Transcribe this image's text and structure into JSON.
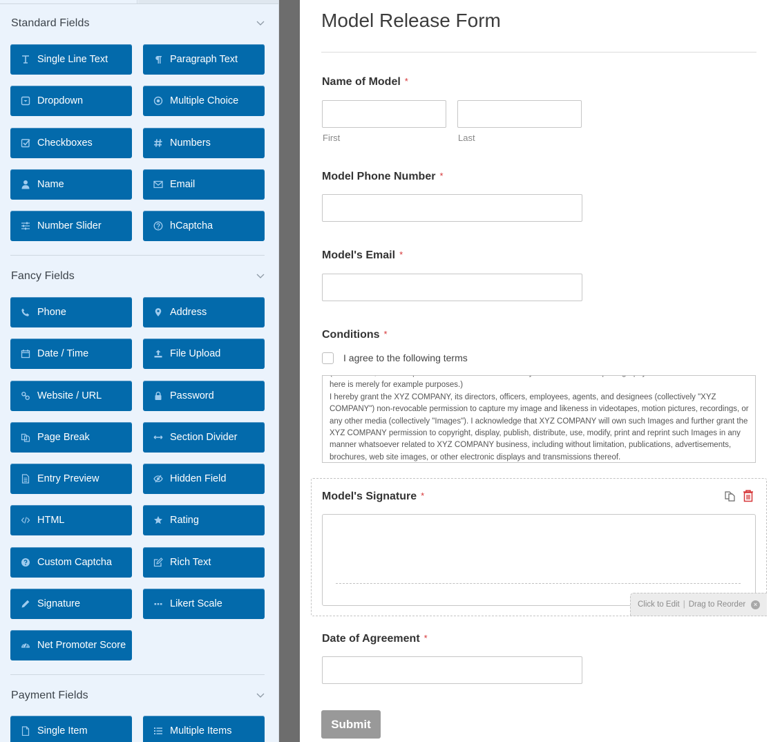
{
  "sidebar": {
    "sections": {
      "standard": {
        "title": "Standard Fields",
        "items": [
          {
            "label": "Single Line Text",
            "icon": "text-cursor-icon"
          },
          {
            "label": "Paragraph Text",
            "icon": "paragraph-icon"
          },
          {
            "label": "Dropdown",
            "icon": "dropdown-icon"
          },
          {
            "label": "Multiple Choice",
            "icon": "radio-icon"
          },
          {
            "label": "Checkboxes",
            "icon": "checkbox-icon"
          },
          {
            "label": "Numbers",
            "icon": "hash-icon"
          },
          {
            "label": "Name",
            "icon": "user-icon"
          },
          {
            "label": "Email",
            "icon": "envelope-icon"
          },
          {
            "label": "Number Slider",
            "icon": "sliders-icon"
          },
          {
            "label": "hCaptcha",
            "icon": "question-circle-icon"
          }
        ]
      },
      "fancy": {
        "title": "Fancy Fields",
        "items": [
          {
            "label": "Phone",
            "icon": "phone-icon"
          },
          {
            "label": "Address",
            "icon": "map-marker-icon"
          },
          {
            "label": "Date / Time",
            "icon": "calendar-icon"
          },
          {
            "label": "File Upload",
            "icon": "upload-icon"
          },
          {
            "label": "Website / URL",
            "icon": "link-icon"
          },
          {
            "label": "Password",
            "icon": "lock-icon"
          },
          {
            "label": "Page Break",
            "icon": "copy-icon"
          },
          {
            "label": "Section Divider",
            "icon": "arrows-h-icon"
          },
          {
            "label": "Entry Preview",
            "icon": "file-text-icon"
          },
          {
            "label": "Hidden Field",
            "icon": "eye-slash-icon"
          },
          {
            "label": "HTML",
            "icon": "code-icon"
          },
          {
            "label": "Rating",
            "icon": "star-icon"
          },
          {
            "label": "Custom Captcha",
            "icon": "question-circle-filled-icon"
          },
          {
            "label": "Rich Text",
            "icon": "edit-icon"
          },
          {
            "label": "Signature",
            "icon": "pencil-icon"
          },
          {
            "label": "Likert Scale",
            "icon": "ellipsis-icon"
          },
          {
            "label": "Net Promoter Score",
            "icon": "tachometer-icon"
          }
        ]
      },
      "payment": {
        "title": "Payment Fields",
        "items": [
          {
            "label": "Single Item",
            "icon": "file-icon"
          },
          {
            "label": "Multiple Items",
            "icon": "list-icon"
          }
        ]
      }
    }
  },
  "form": {
    "title": "Model Release Form",
    "required_marker": "*",
    "fields": {
      "name": {
        "label": "Name of Model",
        "first": "First",
        "last": "Last",
        "first_value": "",
        "last_value": ""
      },
      "phone": {
        "label": "Model Phone Number",
        "value": ""
      },
      "email": {
        "label": "Model's Email",
        "value": ""
      },
      "conditions": {
        "label": "Conditions",
        "checkbox_label": "I agree to the following terms",
        "checked": false,
        "terms_line_partial": "(Please note, this example form does not constitute a fully written and usable photography release. The content",
        "terms_text": "here is merely for example purposes.)\nI hereby grant the XYZ COMPANY, its directors, officers, employees, agents, and designees (collectively \"XYZ COMPANY\") non-revocable permission to capture my image and likeness in videotapes, motion pictures, recordings, or any other media (collectively \"Images\"). I acknowledge that XYZ COMPANY will own such Images and further grant the XYZ COMPANY permission to copyright, display, publish, distribute, use, modify, print and reprint such Images in any manner whatsoever related to XYZ COMPANY business, including without limitation, publications, advertisements, brochures, web site images, or other electronic displays and transmissions thereof."
      },
      "signature": {
        "label": "Model's Signature"
      },
      "date": {
        "label": "Date of Agreement",
        "value": ""
      }
    },
    "edit_hint": {
      "click": "Click to Edit",
      "separator": "|",
      "drag": "Drag to Reorder"
    },
    "submit_label": "Submit"
  },
  "colors": {
    "button_bg": "#036aab",
    "sidebar_bg": "#ebf3fc",
    "required": "#d63638",
    "delete_icon": "#d63638",
    "submit_bg": "#999999"
  }
}
